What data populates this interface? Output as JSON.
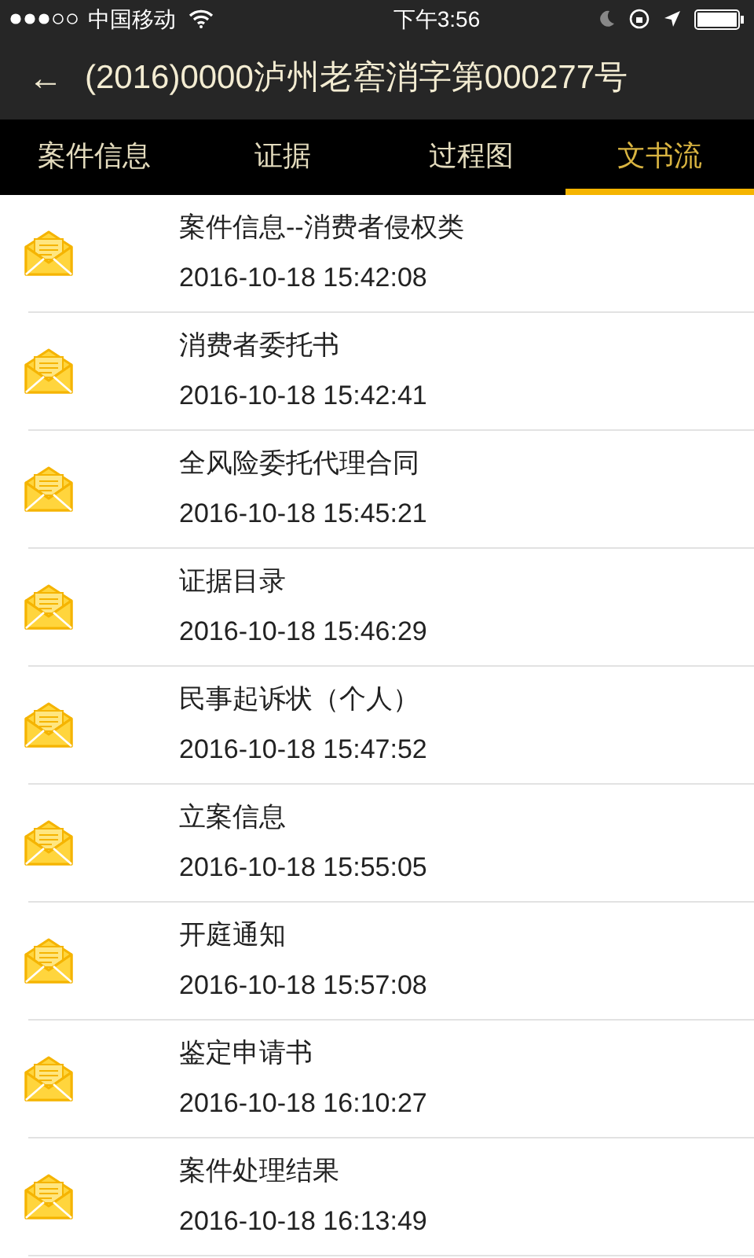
{
  "status_bar": {
    "carrier": "中国移动",
    "time": "下午3:56"
  },
  "header": {
    "back": "←",
    "title": "(2016)0000泸州老窖消字第000277号"
  },
  "tabs": [
    {
      "label": "案件信息",
      "selected": false
    },
    {
      "label": "证据",
      "selected": false
    },
    {
      "label": "过程图",
      "selected": false
    },
    {
      "label": "文书流",
      "selected": true
    }
  ],
  "documents": [
    {
      "title": "案件信息--消费者侵权类",
      "time": "2016-10-18 15:42:08"
    },
    {
      "title": "消费者委托书",
      "time": "2016-10-18 15:42:41"
    },
    {
      "title": "全风险委托代理合同",
      "time": "2016-10-18 15:45:21"
    },
    {
      "title": "证据目录",
      "time": "2016-10-18 15:46:29"
    },
    {
      "title": "民事起诉状（个人）",
      "time": "2016-10-18 15:47:52"
    },
    {
      "title": "立案信息",
      "time": "2016-10-18 15:55:05"
    },
    {
      "title": "开庭通知",
      "time": "2016-10-18 15:57:08"
    },
    {
      "title": "鉴定申请书",
      "time": "2016-10-18 16:10:27"
    },
    {
      "title": "案件处理结果",
      "time": "2016-10-18 16:13:49"
    }
  ]
}
